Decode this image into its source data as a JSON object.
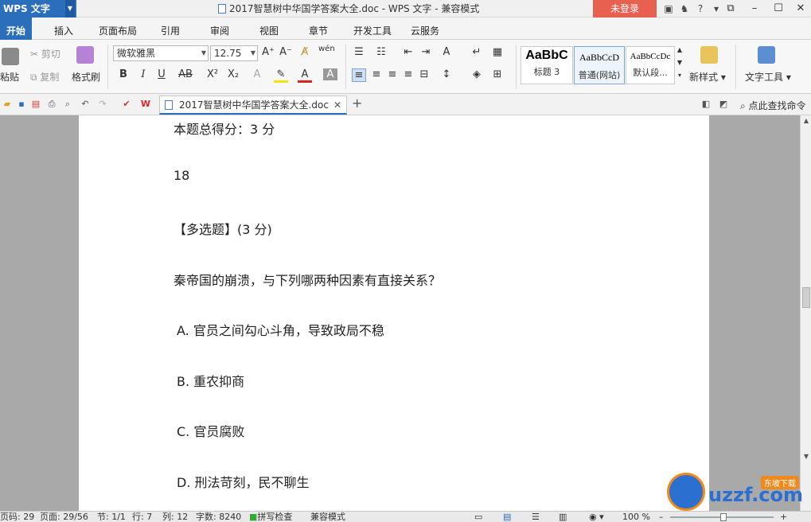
{
  "titlebar": {
    "app_name": "WPS 文字",
    "title": "2017智慧树中华国学答案大全.doc - WPS 文字 - 兼容模式",
    "login_label": "未登录"
  },
  "menu": {
    "tabs": [
      "开始",
      "插入",
      "页面布局",
      "引用",
      "审阅",
      "视图",
      "章节",
      "开发工具",
      "云服务"
    ],
    "active": "开始"
  },
  "ribbon": {
    "paste": "粘贴",
    "cut": "剪切",
    "copy": "复制",
    "format_painter": "格式刷",
    "font_name": "微软雅黑",
    "font_size": "12.75",
    "styles": [
      {
        "sample": "AaBbC",
        "name": "标题 3"
      },
      {
        "sample": "AaBbCcD",
        "name": "普通(网站)"
      },
      {
        "sample": "AaBbCcDc",
        "name": "默认段..."
      }
    ],
    "new_style": "新样式",
    "text_tools": "文字工具"
  },
  "quickbar": {
    "doc_tab": "2017智慧树中华国学答案大全.doc",
    "search_cmd": "点此查找命令"
  },
  "document": {
    "lines": [
      "本题总得分：3 分",
      "18",
      "【多选题】(3 分)",
      "秦帝国的崩溃，与下列哪两种因素有直接关系？",
      "A.  官员之间勾心斗角，导致政局不稳",
      "B.  重农抑商",
      "C.  官员腐败",
      "D.  刑法苛刻，民不聊生"
    ]
  },
  "status": {
    "para": "页码: 29",
    "page": "页面: 29/56",
    "section": "节: 1/1",
    "row": "行: 7",
    "col": "列: 12",
    "words": "字数: 8240",
    "spell": "拼写检查",
    "mode": "兼容模式",
    "zoom": "100 %"
  },
  "watermark": {
    "text": "uzzf.com",
    "tag": "东坡下载"
  }
}
